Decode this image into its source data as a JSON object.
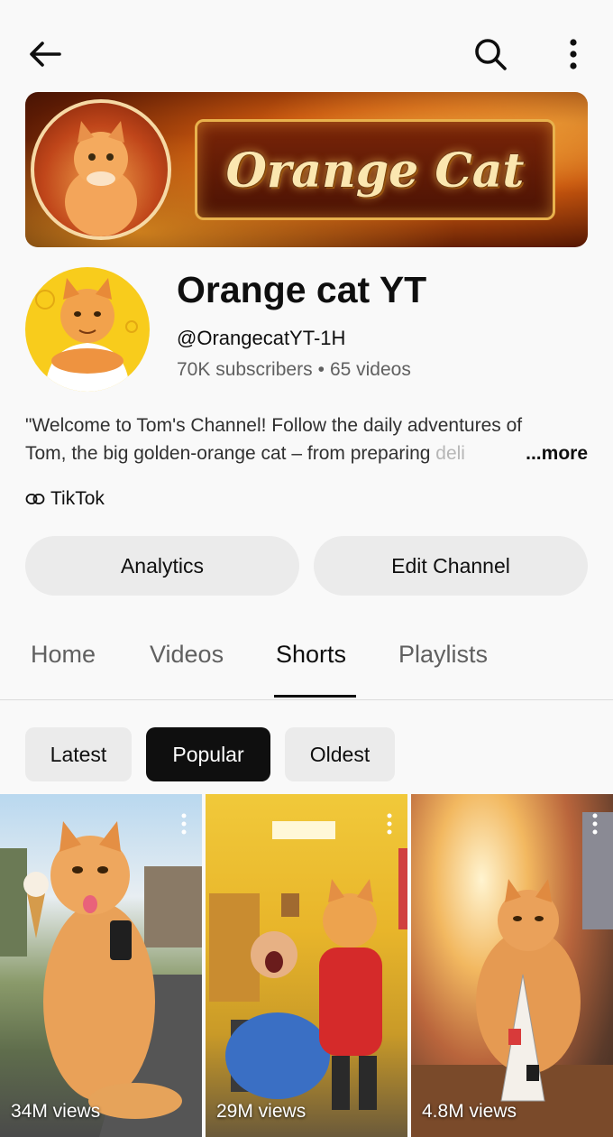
{
  "header": {
    "back_icon": "arrow-left-icon",
    "search_icon": "search-icon",
    "more_icon": "more-vertical-icon"
  },
  "banner": {
    "title": "Orange Cat"
  },
  "channel": {
    "name": "Orange cat YT",
    "handle": "@OrangecatYT-1H",
    "subscribers": "70K subscribers",
    "separator": "•",
    "videos": "65 videos",
    "description_line1": "\"Welcome to Tom's Channel! Follow the daily adventures of",
    "description_line2": "Tom, the big golden-orange cat – from preparing ",
    "description_fade": "deli",
    "more_label": "...more",
    "link_label": "TikTok",
    "link_icon": "link-icon"
  },
  "actions": {
    "analytics": "Analytics",
    "edit_channel": "Edit Channel"
  },
  "tabs": [
    {
      "label": "Home",
      "active": false
    },
    {
      "label": "Videos",
      "active": false
    },
    {
      "label": "Shorts",
      "active": true
    },
    {
      "label": "Playlists",
      "active": false
    }
  ],
  "filters": [
    {
      "label": "Latest",
      "active": false
    },
    {
      "label": "Popular",
      "active": true
    },
    {
      "label": "Oldest",
      "active": false
    }
  ],
  "shorts": [
    {
      "views": "34M views"
    },
    {
      "views": "29M views"
    },
    {
      "views": "4.8M views"
    }
  ],
  "colors": {
    "accent_dark": "#0f0f0f",
    "chip_bg": "#ebebeb",
    "secondary_text": "#606060",
    "avatar_bg": "#f8cc1c"
  }
}
